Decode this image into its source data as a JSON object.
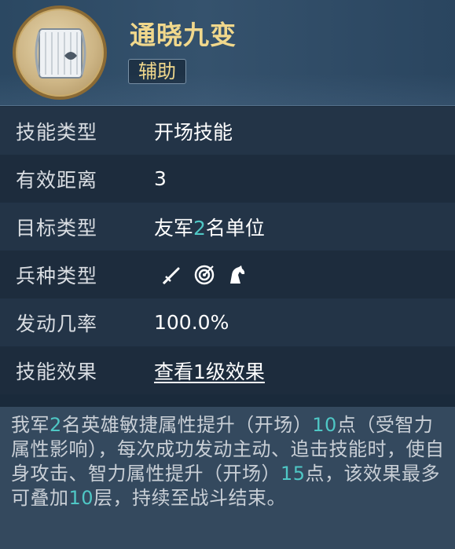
{
  "skill": {
    "name": "通晓九变",
    "tag": "辅助",
    "icon": "scroll-icon"
  },
  "rows": [
    {
      "label": "技能类型",
      "value": "开场技能"
    },
    {
      "label": "有效距离",
      "value": "3"
    },
    {
      "label": "目标类型",
      "value_pre": "友军",
      "value_num": "2",
      "value_post": "名单位"
    },
    {
      "label": "兵种类型",
      "icons": [
        "sword-icon",
        "target-icon",
        "horse-icon"
      ]
    },
    {
      "label": "发动几率",
      "value": "100.0%"
    },
    {
      "label": "技能效果",
      "link": "查看1级效果"
    }
  ],
  "description": {
    "p1": "我军",
    "n1": "2",
    "p2": "名英雄敏捷属性提升（开场）",
    "n2": "10",
    "p3": "点（受智力属性影响），每次成功发动主动、追击技能时，使自身攻击、智力属性提升（开场）",
    "n3": "15",
    "p4": "点，该效果最多可叠加",
    "n4": "10",
    "p5": "层，持续至战斗结束。"
  },
  "colors": {
    "title": "#f1d88c",
    "highlight": "#4fc7c5"
  }
}
